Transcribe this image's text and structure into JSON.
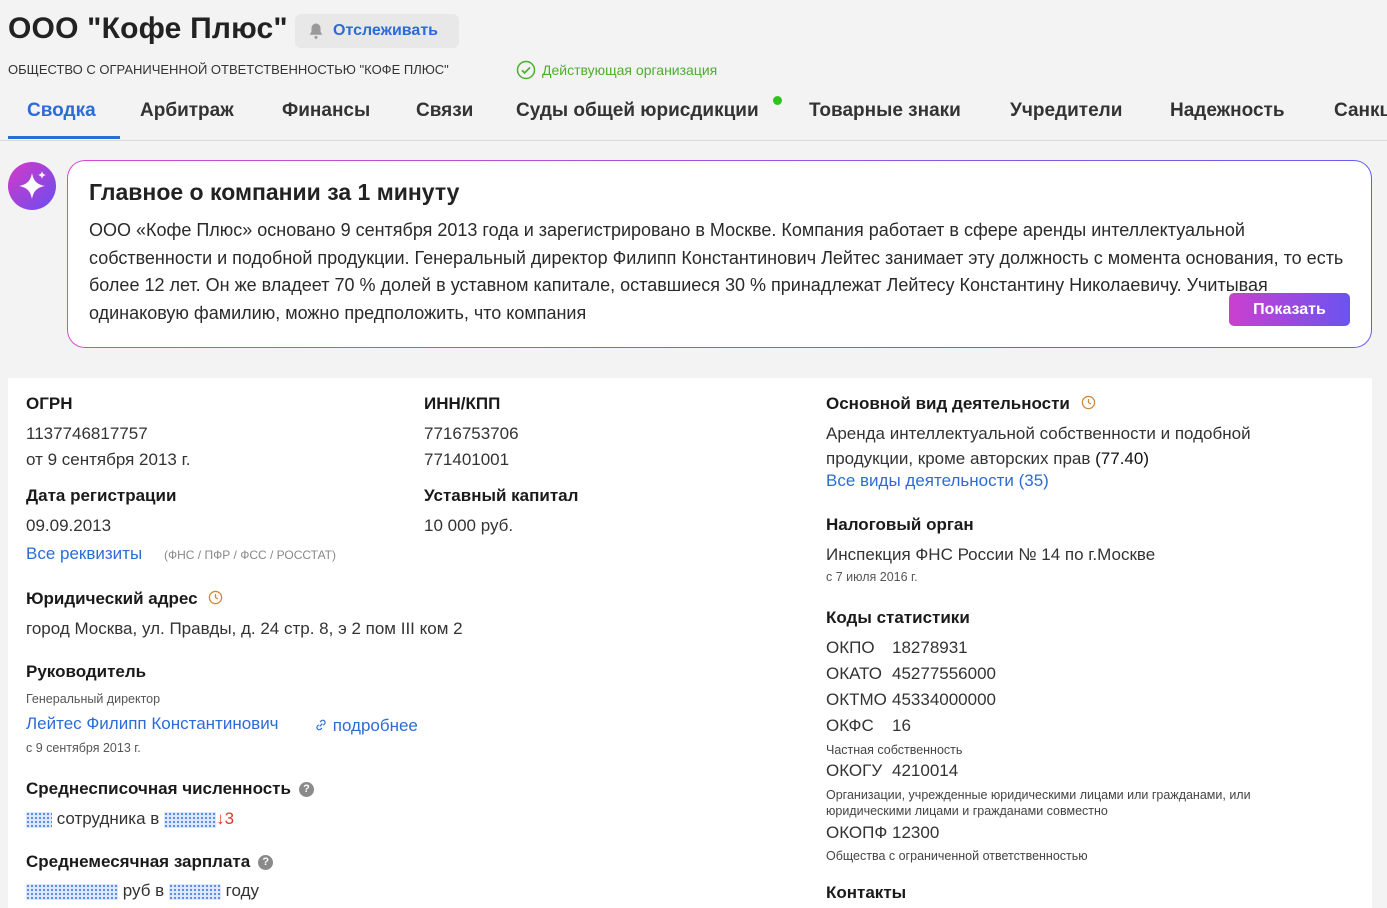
{
  "header": {
    "title": "ООО \"Кофе Плюс\"",
    "track_label": "Отслеживать",
    "full_name": "ОБЩЕСТВО С ОГРАНИЧЕННОЙ ОТВЕТСТВЕННОСТЬЮ \"КОФЕ ПЛЮС\"",
    "status": "Действующая организация",
    "status_color": "#4caf2a"
  },
  "tabs": [
    {
      "label": "Сводка",
      "active": true
    },
    {
      "label": "Арбитраж"
    },
    {
      "label": "Финансы"
    },
    {
      "label": "Связи"
    },
    {
      "label": "Суды общей юрисдикции",
      "badge": "green-dot"
    },
    {
      "label": "Товарные знаки"
    },
    {
      "label": "Учредители"
    },
    {
      "label": "Надежность"
    },
    {
      "label": "Санкц"
    }
  ],
  "ai_summary": {
    "icon": "sparkle-icon",
    "title": "Главное о компании за 1 минуту",
    "text": "ООО «Кофе Плюс» основано 9 сентября 2013 года и зарегистрировано в Москве. Компания работает в сфере аренды интеллектуальной собственности и подобной продукции. Генеральный директор Филипп Константинович Лейтес занимает эту должность с момента основания, то есть более 12 лет. Он же владеет 70 % долей в уставном капитале, оставшиеся 30 % принадлежат Лейтесу Константину Николаевичу. Учитывая одинаковую фамилию, можно предположить, что компания",
    "show_label": "Показать"
  },
  "requisites": {
    "ogrn_label": "ОГРН",
    "ogrn": "1137746817757",
    "ogrn_date": "от 9 сентября 2013 г.",
    "inn_label": "ИНН/КПП",
    "inn": "7716753706",
    "kpp": "771401001",
    "reg_date_label": "Дата регистрации",
    "reg_date": "09.09.2013",
    "capital_label": "Уставный капитал",
    "capital": "10 000 руб.",
    "all_link": "Все реквизиты",
    "all_sources": "(ФНС / ПФР / ФСС / РОССТАТ)",
    "address_label": "Юридический адрес",
    "address": "город Москва, ул. Правды, д. 24 стр. 8, э 2 пом III ком 2",
    "head_label": "Руководитель",
    "head_role": "Генеральный директор",
    "head_name": "Лейтес Филипп Константинович",
    "head_more": "подробнее",
    "head_since": "с 9 сентября 2013 г.",
    "staff_label": "Среднесписочная численность",
    "staff_text": "сотрудника в",
    "staff_change": "↓3",
    "salary_label": "Среднемесячная зарплата",
    "salary_text_1": "руб в",
    "salary_text_2": "году"
  },
  "activity": {
    "label": "Основной вид деятельности",
    "line1": "Аренда интеллектуальной собственности и подобной",
    "line2": "продукции, кроме авторских прав",
    "code": "(77.40)",
    "all_link": "Все виды деятельности (35)"
  },
  "tax": {
    "label": "Налоговый орган",
    "value": "Инспекция ФНС России № 14 по г.Москве",
    "since": "с 7 июля 2016 г."
  },
  "stats": {
    "label": "Коды статистики",
    "okpo_k": "ОКПО",
    "okpo_v": "18278931",
    "okato_k": "ОКАТО",
    "okato_v": "45277556000",
    "oktmo_k": "ОКТМО",
    "oktmo_v": "45334000000",
    "okfs_k": "ОКФС",
    "okfs_v": "16",
    "okfs_note": "Частная собственность",
    "okogu_k": "ОКОГУ",
    "okogu_v": "4210014",
    "okogu_note1": "Организации, учрежденные юридическими лицами или гражданами, или",
    "okogu_note2": "юридическими лицами и гражданами совместно",
    "okopf_k": "ОКОПФ",
    "okopf_v": "12300",
    "okopf_note": "Общества с ограниченной ответственностью"
  },
  "contacts_label": "Контакты",
  "colors": {
    "accent": "#2b6cd6",
    "ai_gradient_start": "#cc3fd0",
    "ai_gradient_end": "#6a54ef",
    "negative": "#e03b2c"
  }
}
